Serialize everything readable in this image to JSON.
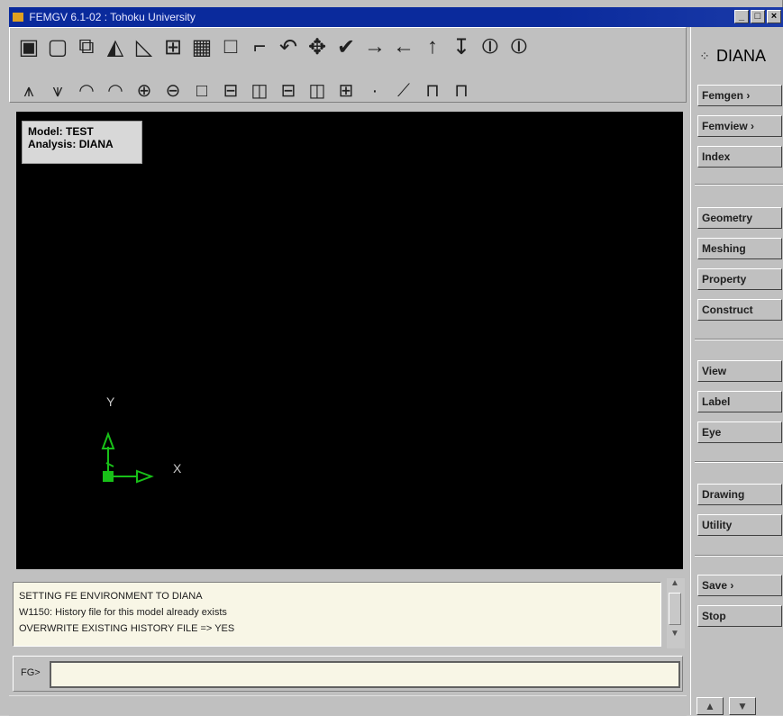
{
  "window": {
    "title": "FEMGV 6.1-02 : Tohoku University",
    "minimize_label": "_",
    "maximize_label": "□",
    "close_label": "×"
  },
  "toolbar": {
    "row1_icons": [
      {
        "name": "solid-box-icon",
        "glyph": "▣"
      },
      {
        "name": "wire-box-icon",
        "glyph": "▢"
      },
      {
        "name": "hidden-box-icon",
        "glyph": "⧉"
      },
      {
        "name": "shaded-curve-icon",
        "glyph": "◭"
      },
      {
        "name": "curve-outline-icon",
        "glyph": "◺"
      },
      {
        "name": "mesh-grid-icon",
        "glyph": "⊞"
      },
      {
        "name": "mesh-grid-fine-icon",
        "glyph": "▦"
      },
      {
        "name": "blank-square-icon",
        "glyph": "□"
      },
      {
        "name": "partial-square-icon",
        "glyph": "⌐"
      },
      {
        "name": "rotate-icon",
        "glyph": "↶"
      },
      {
        "name": "move-icon",
        "glyph": "✥"
      },
      {
        "name": "pick-icon",
        "glyph": "✔"
      },
      {
        "name": "arrow-right-icon",
        "glyph": "→"
      },
      {
        "name": "arrow-left-icon",
        "glyph": "←"
      },
      {
        "name": "arrow-up-icon",
        "glyph": "↑"
      },
      {
        "name": "arrow-down-icon",
        "glyph": "↧"
      },
      {
        "name": "spin-x-icon",
        "glyph": "⦶"
      },
      {
        "name": "spin-y-icon",
        "glyph": "⦶"
      }
    ],
    "row2_icons": [
      {
        "name": "view-a-icon",
        "glyph": "⩚"
      },
      {
        "name": "view-b-icon",
        "glyph": "⩛"
      },
      {
        "name": "rotate-ccw-icon",
        "glyph": "◠"
      },
      {
        "name": "rotate-cw-icon",
        "glyph": "◠"
      },
      {
        "name": "zoom-in-icon",
        "glyph": "⊕"
      },
      {
        "name": "zoom-out-icon",
        "glyph": "⊖"
      },
      {
        "name": "frame-icon",
        "glyph": "□"
      },
      {
        "name": "frame-top-icon",
        "glyph": "⊟"
      },
      {
        "name": "frame-split-icon",
        "glyph": "◫"
      },
      {
        "name": "frame-mid-icon",
        "glyph": "⊟"
      },
      {
        "name": "frame-cols-icon",
        "glyph": "◫"
      },
      {
        "name": "frame-quad-icon",
        "glyph": "⊞"
      },
      {
        "name": "point-icon",
        "glyph": "·"
      },
      {
        "name": "line-icon",
        "glyph": "⟋"
      },
      {
        "name": "surface-icon",
        "glyph": "⊓"
      },
      {
        "name": "solid-icon",
        "glyph": "⊓"
      }
    ]
  },
  "viewport": {
    "model_line": "Model: TEST",
    "analysis_line": "Analysis: DIANA",
    "axis_x": "X",
    "axis_y": "Y",
    "axis_color": "#18c018"
  },
  "messages": [
    "SETTING FE ENVIRONMENT TO DIANA",
    "W1150: History file for this model already exists",
    "OVERWRITE EXISTING HISTORY FILE => YES"
  ],
  "command": {
    "prompt": "FG>",
    "value": ""
  },
  "sidebar": {
    "brand": "DIANA",
    "buttons": [
      {
        "id": "femgen",
        "label": "Femgen ›"
      },
      {
        "id": "femview",
        "label": "Femview ›"
      },
      {
        "id": "index",
        "label": "Index"
      },
      {
        "id": "geometry",
        "label": "Geometry"
      },
      {
        "id": "meshing",
        "label": "Meshing"
      },
      {
        "id": "property",
        "label": "Property"
      },
      {
        "id": "construct",
        "label": "Construct"
      },
      {
        "id": "view",
        "label": "View"
      },
      {
        "id": "label",
        "label": "Label"
      },
      {
        "id": "eye",
        "label": "Eye"
      },
      {
        "id": "drawing",
        "label": "Drawing"
      },
      {
        "id": "utility",
        "label": "Utility"
      },
      {
        "id": "save",
        "label": "Save ›"
      },
      {
        "id": "stop",
        "label": "Stop"
      }
    ],
    "nav_up": "▲",
    "nav_down": "▼"
  }
}
